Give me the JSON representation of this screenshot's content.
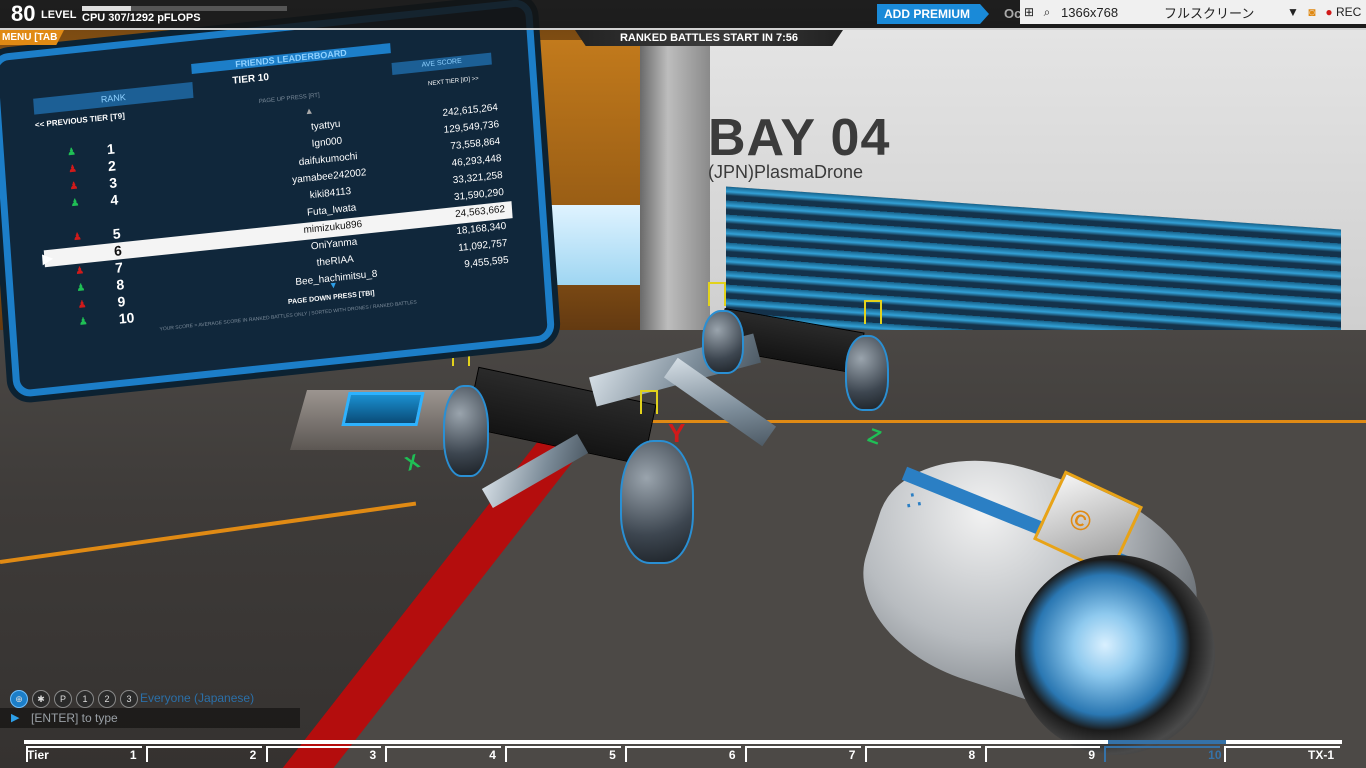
{
  "hud": {
    "level_number": "80",
    "level_label": "LEVEL",
    "cpu_text": "CPU 307/1292 pFLOPS",
    "cpu_fraction": 0.2376,
    "premium_button": "ADD PREMIUM",
    "premium_next": "Oc",
    "menu_tab": "MENU [TAB",
    "ranked_banner": "RANKED BATTLES START IN 7:56"
  },
  "capture_tool": {
    "resolution": "1366x768",
    "mode": "フルスクリーン",
    "rec_label": "REC"
  },
  "bay": {
    "title": "BAY 04",
    "owner": "(JPN)PlasmaDrone"
  },
  "leaderboard": {
    "title": "FRIENDS LEADERBOARD",
    "rank_header": "RANK",
    "tier": "TIER 10",
    "score_header": "AVE SCORE",
    "prev_tier": "<< PREVIOUS TIER [T9]",
    "page_up": "PAGE UP PRESS [RT]",
    "next_tier": "NEXT TIER [ID] >>",
    "page_down": "PAGE DOWN PRESS [TBI]",
    "footer": "YOUR SCORE = AVERAGE SCORE IN RANKED BATTLES ONLY | SORTED WITH DRONES / RANKED BATTLES",
    "rows": [
      {
        "rank": "1",
        "name": "tyattyu",
        "score": "242,615,264",
        "trend": "up",
        "highlight": false
      },
      {
        "rank": "2",
        "name": "Ign000",
        "score": "129,549,736",
        "trend": "down",
        "highlight": false
      },
      {
        "rank": "3",
        "name": "daifukumochi",
        "score": "73,558,864",
        "trend": "down",
        "highlight": false
      },
      {
        "rank": "4",
        "name": "yamabee242002",
        "score": "46,293,448",
        "trend": "up",
        "highlight": false
      },
      {
        "rank": "",
        "name": "kiki84113",
        "score": "33,321,258",
        "trend": "",
        "highlight": false
      },
      {
        "rank": "5",
        "name": "Futa_Iwata",
        "score": "31,590,290",
        "trend": "down",
        "highlight": true
      },
      {
        "rank": "6",
        "name": "mimizuku896",
        "score": "24,563,662",
        "trend": "",
        "highlight": true
      },
      {
        "rank": "7",
        "name": "OniYanma",
        "score": "18,168,340",
        "trend": "down",
        "highlight": false
      },
      {
        "rank": "8",
        "name": "theRIAA",
        "score": "11,092,757",
        "trend": "up",
        "highlight": false
      },
      {
        "rank": "9",
        "name": "Bee_hachimitsu_8",
        "score": "9,455,595",
        "trend": "down",
        "highlight": false
      },
      {
        "rank": "10",
        "name": "",
        "score": "",
        "trend": "up",
        "highlight": false
      }
    ]
  },
  "chat": {
    "channel": "Everyone (Japanese)",
    "placeholder": "[ENTER] to type",
    "icons": [
      "globe-icon",
      "accessibility-icon",
      "p-icon",
      "party-1-icon",
      "party-2-icon",
      "party-3-icon"
    ]
  },
  "tier_bar": {
    "labels": [
      "Tier",
      "1",
      "2",
      "3",
      "4",
      "5",
      "6",
      "7",
      "8",
      "9",
      "10",
      "TX-1"
    ],
    "active_index": 10
  },
  "axes": {
    "x": "X",
    "y": "Y",
    "z": "Z"
  },
  "colors": {
    "accent_orange": "#e08a14",
    "accent_blue": "#1c7ec8",
    "premium_blue": "#1a8ad8",
    "tier_active": "#3572a8"
  }
}
